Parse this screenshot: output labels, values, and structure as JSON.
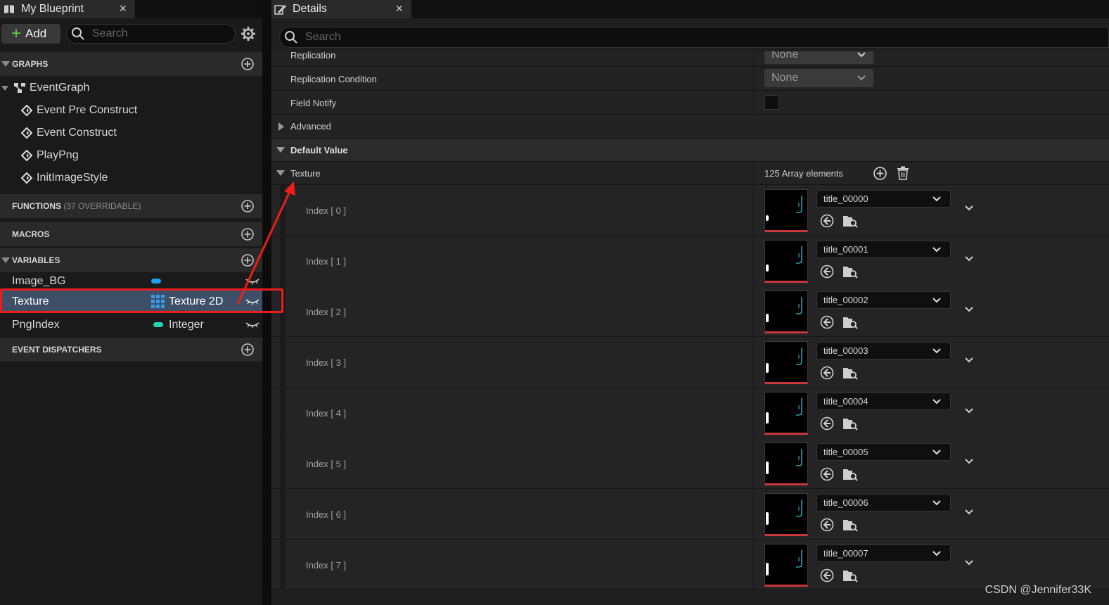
{
  "left_panel": {
    "tab_title": "My Blueprint",
    "tab_close": "×",
    "add_label": "Add",
    "search_placeholder": "Search",
    "sections": {
      "graphs": "GRAPHS",
      "functions": "FUNCTIONS",
      "functions_sub": "(37 OVERRIDABLE)",
      "macros": "MACROS",
      "variables": "VARIABLES",
      "dispatchers": "EVENT DISPATCHERS"
    },
    "graph_root": "EventGraph",
    "events": [
      "Event Pre Construct",
      "Event Construct",
      "PlayPng",
      "InitImageStyle"
    ],
    "variables": [
      {
        "name": "Image_BG",
        "type": "",
        "color": "#1aa2f0"
      },
      {
        "name": "Texture",
        "type": "Texture 2D",
        "color": "#3a9ae8"
      },
      {
        "name": "PngIndex",
        "type": "Integer",
        "color": "#1fd8b0"
      }
    ]
  },
  "details_panel": {
    "tab_title": "Details",
    "tab_close": "×",
    "search_placeholder": "Search",
    "rows": {
      "replication_label": "Replication",
      "replication_value": "None",
      "replication_cond_label": "Replication Condition",
      "replication_cond_value": "None",
      "field_notify_label": "Field Notify",
      "advanced_label": "Advanced",
      "default_value_label": "Default Value",
      "texture_label": "Texture",
      "array_count": "125 Array elements"
    },
    "elements": [
      {
        "index": "Index [ 0 ]",
        "asset": "title_00000"
      },
      {
        "index": "Index [ 1 ]",
        "asset": "title_00001"
      },
      {
        "index": "Index [ 2 ]",
        "asset": "title_00002"
      },
      {
        "index": "Index [ 3 ]",
        "asset": "title_00003"
      },
      {
        "index": "Index [ 4 ]",
        "asset": "title_00004"
      },
      {
        "index": "Index [ 5 ]",
        "asset": "title_00005"
      },
      {
        "index": "Index [ 6 ]",
        "asset": "title_00006"
      },
      {
        "index": "Index [ 7 ]",
        "asset": "title_00007"
      }
    ]
  },
  "watermark": "CSDN @Jennifer33K",
  "colors": {
    "highlight": "#ee1c1c",
    "selection": "#3e5068",
    "add_plus": "#6ac84a"
  }
}
